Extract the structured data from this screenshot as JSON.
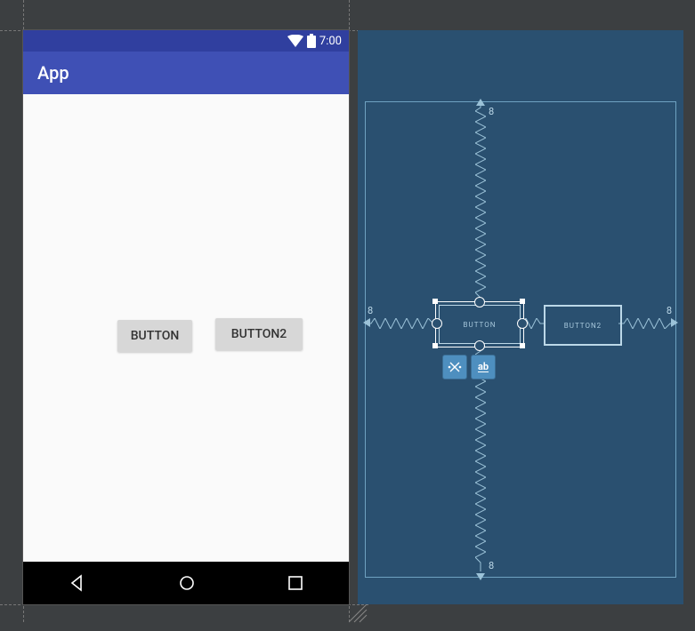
{
  "statusbar": {
    "time": "7:00"
  },
  "appbar": {
    "title": "App"
  },
  "buttons": {
    "b1": "BUTTON",
    "b2": "BUTTON2"
  },
  "blueprint": {
    "b1": "BUTTON",
    "b2": "BUTTON2",
    "margins": {
      "top": "8",
      "left": "8",
      "right": "8",
      "bottom": "8"
    },
    "actions": {
      "clear": "×",
      "edit": "ab"
    }
  }
}
